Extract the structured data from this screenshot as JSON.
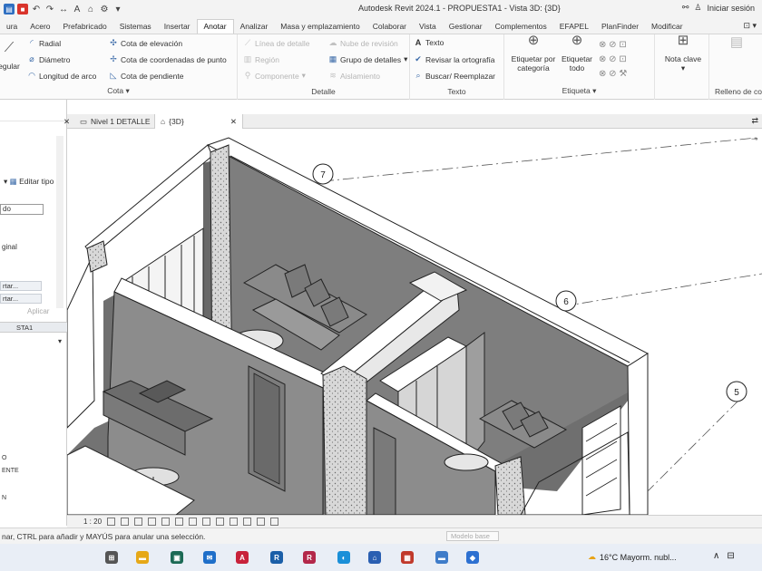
{
  "window": {
    "title": "Autodesk Revit 2024.1 - PROPUESTA1 - Vista 3D: {3D}",
    "sign_in_label": "Iniciar sesión",
    "sign_in_icon": "user-icon",
    "binoculars_icon": "binoculars-icon"
  },
  "quick_access": [
    "open-icon",
    "save-icon",
    "undo-icon",
    "redo-icon",
    "measure-icon",
    "text-icon",
    "3d-view-icon",
    "settings-icon",
    "dropdown-icon"
  ],
  "ribbon_tabs": [
    {
      "label": "ura",
      "active": false
    },
    {
      "label": "Acero",
      "active": false
    },
    {
      "label": "Prefabricado",
      "active": false
    },
    {
      "label": "Sistemas",
      "active": false
    },
    {
      "label": "Insertar",
      "active": false
    },
    {
      "label": "Anotar",
      "active": true
    },
    {
      "label": "Analizar",
      "active": false
    },
    {
      "label": "Masa y emplazamiento",
      "active": false
    },
    {
      "label": "Colaborar",
      "active": false
    },
    {
      "label": "Vista",
      "active": false
    },
    {
      "label": "Gestionar",
      "active": false
    },
    {
      "label": "Complementos",
      "active": false
    },
    {
      "label": "EFAPEL",
      "active": false
    },
    {
      "label": "PlanFinder",
      "active": false
    },
    {
      "label": "Modificar",
      "active": false
    }
  ],
  "ribbon": {
    "cota": {
      "title": "Cota",
      "items": [
        {
          "label": "Radial",
          "icon": "radial-dimension-icon"
        },
        {
          "label": "Diámetro",
          "icon": "diameter-dimension-icon"
        },
        {
          "label": "Longitud de arco",
          "icon": "arc-length-icon"
        },
        {
          "label": "Cota de elevación",
          "icon": "spot-elevation-icon"
        },
        {
          "label": "Cota de coordenadas de punto",
          "icon": "spot-coordinate-icon"
        },
        {
          "label": "Cota de pendiente",
          "icon": "spot-slope-icon"
        }
      ],
      "partial_label": "egular"
    },
    "detalle": {
      "title": "Detalle",
      "items": [
        {
          "label": "Línea de detalle",
          "enabled": false
        },
        {
          "label": "Región",
          "enabled": false
        },
        {
          "label": "Componente",
          "enabled": false
        },
        {
          "label": "Nube de revisión",
          "enabled": false
        },
        {
          "label": "Grupo de detalles",
          "enabled": true
        },
        {
          "label": "Aislamiento",
          "enabled": false
        }
      ]
    },
    "texto": {
      "title": "Texto",
      "items": [
        {
          "label": "Texto",
          "icon": "text-icon"
        },
        {
          "label": "Revisar la ortografía",
          "icon": "spellcheck-icon"
        },
        {
          "label": "Buscar/ Reemplazar",
          "icon": "find-replace-icon"
        }
      ]
    },
    "etiqueta": {
      "title": "Etiqueta",
      "by_category": "Etiquetar por categoría",
      "all": "Etiquetar todo"
    },
    "nota_clave": {
      "label": "Nota clave"
    },
    "relleno": {
      "title": "Relleno de co"
    }
  },
  "properties": {
    "edit_type": "Editar tipo",
    "field_value": "do",
    "label_partial": "ginal",
    "buttons": [
      "rtar...",
      "rtar..."
    ],
    "apply": "Aplicar"
  },
  "project_browser": {
    "title": "STA1",
    "tree_items": [
      "O",
      "ENTE",
      "N"
    ]
  },
  "view_tabs": [
    {
      "label": "Nivel 1 DETALLE",
      "active": false,
      "icon": "floor-plan-icon"
    },
    {
      "label": "{3D}",
      "active": true,
      "icon": "3d-view-icon"
    }
  ],
  "view_bar": {
    "scale": "1 : 20"
  },
  "drawing": {
    "grid_labels": [
      "7",
      "6",
      "5"
    ]
  },
  "status": {
    "message": "nar, CTRL para añadir y MAYÚS para anular una selección.",
    "model": "Modelo base"
  },
  "taskbar": {
    "weather": "16°C  Mayorm. nubl...",
    "apps": [
      {
        "name": "windows-start-icon",
        "color": "#555555",
        "glyph": "⊞"
      },
      {
        "name": "file-explorer-icon",
        "color": "#e6a817",
        "glyph": "▬"
      },
      {
        "name": "store-icon",
        "color": "#1c6a55",
        "glyph": "▣"
      },
      {
        "name": "mail-icon",
        "color": "#1f6fc9",
        "glyph": "✉"
      },
      {
        "name": "pdf-icon",
        "color": "#c8223a",
        "glyph": "A"
      },
      {
        "name": "revit-icon",
        "color": "#1b5fa8",
        "glyph": "R"
      },
      {
        "name": "revit-icon-2",
        "color": "#b3284a",
        "glyph": "R"
      },
      {
        "name": "edge-icon",
        "color": "#1a8fd8",
        "glyph": "◐"
      },
      {
        "name": "home-icon",
        "color": "#2a5fb2",
        "glyph": "⌂"
      },
      {
        "name": "app-icon",
        "color": "#c0392b",
        "glyph": "▦"
      },
      {
        "name": "folder-icon",
        "color": "#3f7cc9",
        "glyph": "▬"
      },
      {
        "name": "blue-app-icon",
        "color": "#2d70d1",
        "glyph": "◆"
      }
    ],
    "tray": [
      "chevron-up-icon",
      "network-icon"
    ]
  }
}
